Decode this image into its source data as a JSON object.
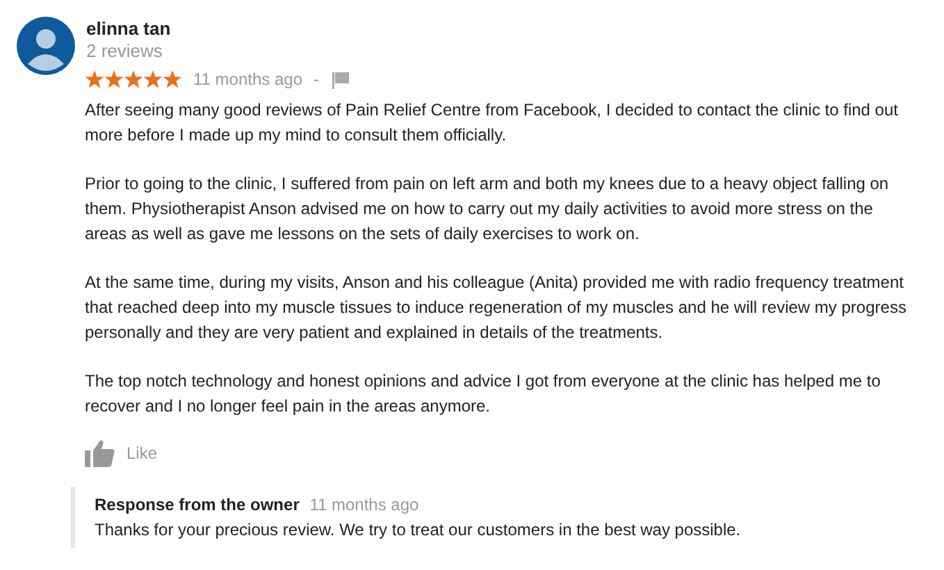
{
  "reviewer": {
    "name": "elinna tan",
    "review_count": "2 reviews"
  },
  "rating": {
    "stars": 5,
    "time": "11 months ago",
    "separator": "-"
  },
  "paragraphs": [
    "After seeing many good reviews of Pain Relief Centre from Facebook, I decided to contact the clinic to find out more before I made up my mind to consult them officially.",
    "Prior to going to the clinic, I suffered from pain on left arm and both my knees due to a heavy object falling on them. Physiotherapist Anson advised me on how to carry out my daily activities to avoid more stress on the areas as well as gave me lessons on the sets of daily exercises to work on.",
    "At the same time, during my visits, Anson and his colleague (Anita) provided me with radio frequency treatment that reached deep into my muscle tissues to induce regeneration of my muscles and he will review my progress personally and they are very patient and explained in details of the treatments.",
    "The top notch technology and honest opinions and advice I got from everyone at the clinic has helped me to recover and I no longer feel pain in the areas anymore."
  ],
  "like": {
    "label": "Like"
  },
  "owner_response": {
    "title": "Response from the owner",
    "time": "11 months ago",
    "text": "Thanks for your precious review. We try to treat our customers in the best way possible."
  }
}
